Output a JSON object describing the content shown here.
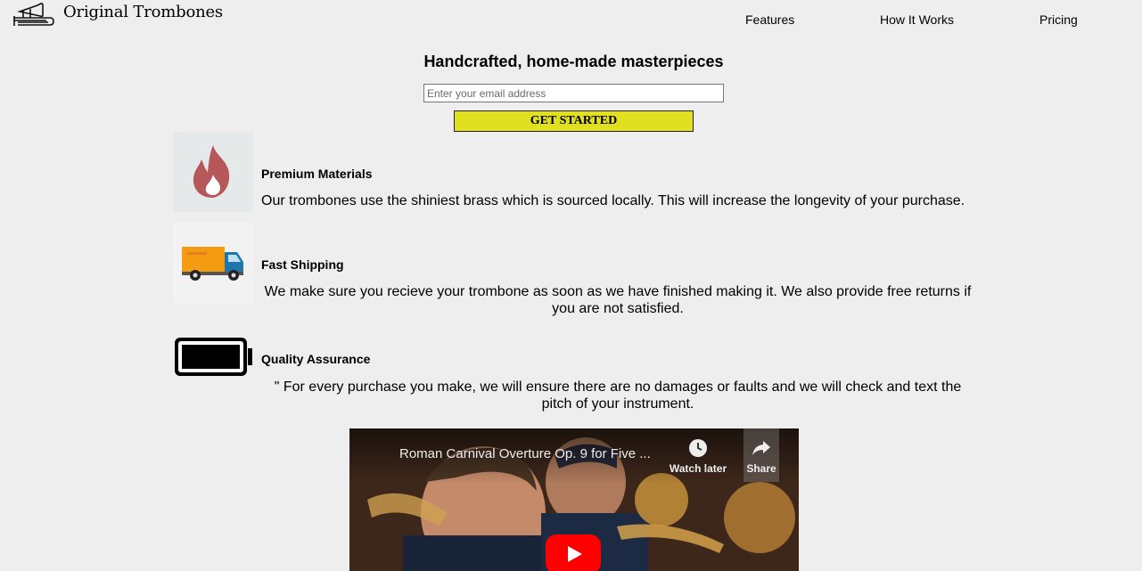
{
  "header": {
    "brand": "Original Trombones",
    "logo_icon": "trombone-icon",
    "nav": [
      {
        "label": "Features"
      },
      {
        "label": "How It Works"
      },
      {
        "label": "Pricing"
      }
    ]
  },
  "hero": {
    "title": "Handcrafted, home-made masterpieces",
    "email_placeholder": "Enter your email address",
    "cta_label": "GET STARTED",
    "cta_color": "#e0e020"
  },
  "features": [
    {
      "icon": "fire-icon",
      "title": "Premium Materials",
      "description": "Our trombones use the shiniest brass which is sourced locally. This will increase the longevity of your purchase."
    },
    {
      "icon": "truck-icon",
      "title": "Fast Shipping",
      "description": "We make sure you recieve your trombone as soon as we have finished making it. We also provide free returns if you are not satisfied."
    },
    {
      "icon": "battery-icon",
      "title": "Quality Assurance",
      "description": "\" For every purchase you make, we will ensure there are no damages or faults and we will check and text the pitch of your instrument."
    }
  ],
  "video": {
    "title": "Roman Carnival Overture Op. 9 for Five ...",
    "watch_later_label": "Watch later",
    "share_label": "Share",
    "play_icon": "youtube-play-icon",
    "accent_color": "#ff0000"
  }
}
